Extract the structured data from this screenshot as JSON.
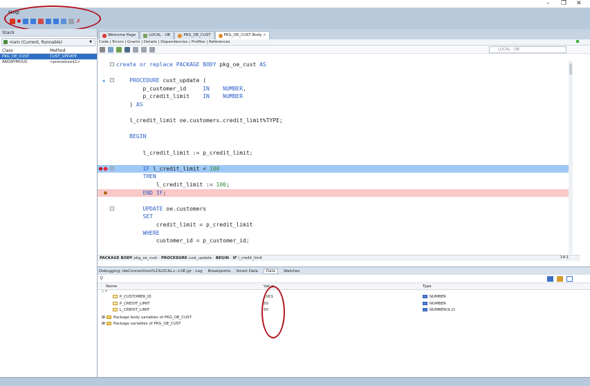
{
  "window": {
    "minimize": "–",
    "maximize": "❐",
    "close": "✕"
  },
  "menubar": {
    "help": "Help"
  },
  "stack_panel": {
    "title": "Stack",
    "thread": "main (Current, Runnable)",
    "columns": [
      "Class",
      "Method"
    ],
    "rows": [
      {
        "class": "PKG_OE_CUST",
        "method": "CUST_UPDATE"
      },
      {
        "class": "ANONYMOUS",
        "method": "<procedure$1>"
      }
    ]
  },
  "doc_tabs": [
    {
      "label": "Welcome Page"
    },
    {
      "label": "LOCAL - OE"
    },
    {
      "label": "PKG_OE_CUST"
    },
    {
      "label": "PKG_OE_CUST Body"
    }
  ],
  "sub_tabs": "Code | Errors | Grants | Details | Dependencies | Profiles | References",
  "connection": "LOCAL - OE",
  "code_lines": [
    {
      "t": "create or replace PACKAGE BODY pkg_oe_cust AS"
    },
    {
      "t": ""
    },
    {
      "t": "    PROCEDURE cust_update ("
    },
    {
      "t": "        p_customer_id     IN    NUMBER,"
    },
    {
      "t": "        p_credit_limit    IN    NUMBER"
    },
    {
      "t": "    ) AS"
    },
    {
      "t": ""
    },
    {
      "t": "    l_credit_limit oe.customers.credit_limit%TYPE;"
    },
    {
      "t": ""
    },
    {
      "t": "    BEGIN"
    },
    {
      "t": ""
    },
    {
      "t": "        l_credit_limit := p_credit_limit;"
    },
    {
      "t": ""
    },
    {
      "t": "        IF l_credit_limit < 100"
    },
    {
      "t": "        THEN"
    },
    {
      "t": "            l_credit_limit := 100;"
    },
    {
      "t": "        END IF;"
    },
    {
      "t": ""
    },
    {
      "t": "        UPDATE oe.customers"
    },
    {
      "t": "        SET"
    },
    {
      "t": "            credit_limit = p_credit_limit"
    },
    {
      "t": "        WHERE"
    },
    {
      "t": "            customer_id = p_customer_id;"
    }
  ],
  "breadcrumb": {
    "items": [
      {
        "kind": "PACKAGE BODY",
        "name": "pkg_oe_cust"
      },
      {
        "kind": "PROCEDURE",
        "name": "cust_update"
      },
      {
        "kind": "BEGIN",
        "name": ""
      },
      {
        "kind": "IF",
        "name": "l_credit_limit"
      }
    ]
  },
  "cursor_position": "14:1",
  "bottom_panel": {
    "tabs": [
      {
        "label": "Debugging: IdeConnections%23LOCAL+-+OE.jpr - Log"
      },
      {
        "label": "Breakpoints"
      },
      {
        "label": "Smart Data"
      },
      {
        "label": "Data"
      },
      {
        "label": "Watches"
      }
    ],
    "columns": {
      "name": "Name",
      "value": "Value",
      "type": "Type"
    },
    "variables": [
      {
        "name": "P_CUSTOMER_ID",
        "value": "1001",
        "type": "NUMBER"
      },
      {
        "name": "P_CREDIT_LIMIT",
        "value": "50",
        "type": "NUMBER"
      },
      {
        "name": "L_CREDIT_LIMIT",
        "value": "50",
        "type": "NUMBER(9,2)"
      }
    ],
    "packages": [
      "Package body variables of PKG_OE_CUST",
      "Package variables of PKG_OE_CUST"
    ]
  },
  "colors": {
    "current_line": "#9ec9f6",
    "breakpoint_line": "#f9c9c9",
    "keyword": "#2a5cc6",
    "annotation": "#b0101a"
  }
}
